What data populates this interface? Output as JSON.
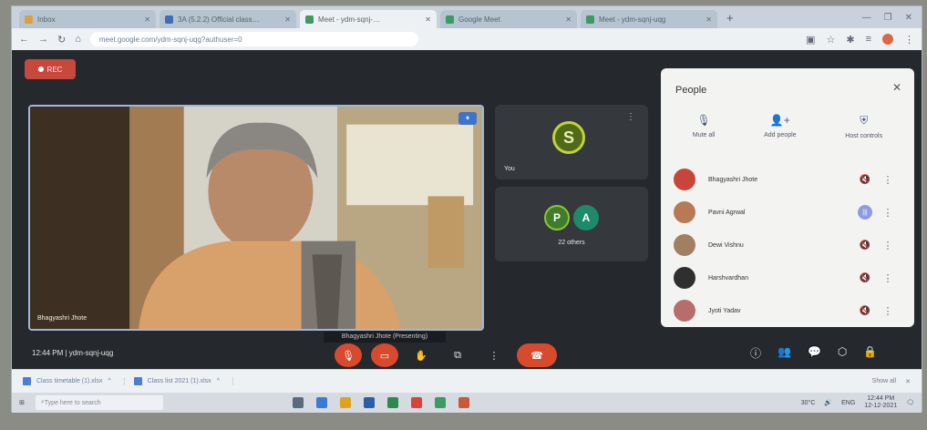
{
  "browser": {
    "tabs": [
      {
        "label": "Inbox",
        "favicon_color": "#d9a23f",
        "active": false
      },
      {
        "label": "3A (5.2.2) Official class…",
        "favicon_color": "#3e6fb5",
        "active": false
      },
      {
        "label": "Meet - ydm-sqnj-…",
        "favicon_color": "#3c9a63",
        "active": true
      },
      {
        "label": "Google Meet",
        "favicon_color": "#3c9a63",
        "active": false
      },
      {
        "label": "Meet - ydm-sqnj-uqg",
        "favicon_color": "#3c9a63",
        "active": false
      }
    ],
    "new_tab": "+",
    "url": "meet.google.com/ydm-sqnj-uqg?authuser=0",
    "window_controls": [
      "—",
      "❐",
      "✕"
    ]
  },
  "meet": {
    "recording_label": "REC",
    "main_speaker_name": "Bhagyashri Jhote",
    "tiles": [
      {
        "avatar_letter": "S",
        "avatar_color": "#4f6b18",
        "name": "You"
      },
      {
        "others": [
          {
            "letter": "P",
            "color": "#3f7d2a"
          },
          {
            "letter": "A",
            "color": "#1f8a6a"
          }
        ],
        "label": "22 others"
      }
    ],
    "caption": "Bhagyashri Jhote (Presenting)",
    "meeting_time": "12:44 PM",
    "meeting_code": "ydm-sqnj-uqg",
    "controls": [
      "mic-off",
      "cam-off",
      "raise-hand",
      "present",
      "more",
      "end-call"
    ]
  },
  "people_panel": {
    "title": "People",
    "actions": [
      {
        "label": "Mute all",
        "icon": "mic-icon"
      },
      {
        "label": "Add people",
        "icon": "add-person-icon"
      },
      {
        "label": "Host controls",
        "icon": "shield-icon"
      }
    ],
    "participants": [
      {
        "name": "Bhagyashri Jhote",
        "avatar_color": "#c8453b",
        "mic": "muted"
      },
      {
        "name": "Pavni Agrwal",
        "avatar_color": "#b77a55",
        "mic": "speaking"
      },
      {
        "name": "Dewi Vishnu",
        "avatar_color": "#a08060",
        "mic": "muted"
      },
      {
        "name": "Harshvardhan",
        "avatar_color": "#2f2f2f",
        "mic": "muted"
      },
      {
        "name": "Jyoti Yadav",
        "avatar_color": "#b86d6d",
        "mic": "muted"
      }
    ]
  },
  "downloads": {
    "items": [
      "Class timetable (1).xlsx",
      "Class list 2021 (1).xlsx"
    ],
    "show_all": "Show all"
  },
  "taskbar": {
    "search_placeholder": "Type here to search",
    "temperature": "30°C",
    "lang": "ENG",
    "time": "12:44 PM",
    "date": "12-12-2021"
  }
}
